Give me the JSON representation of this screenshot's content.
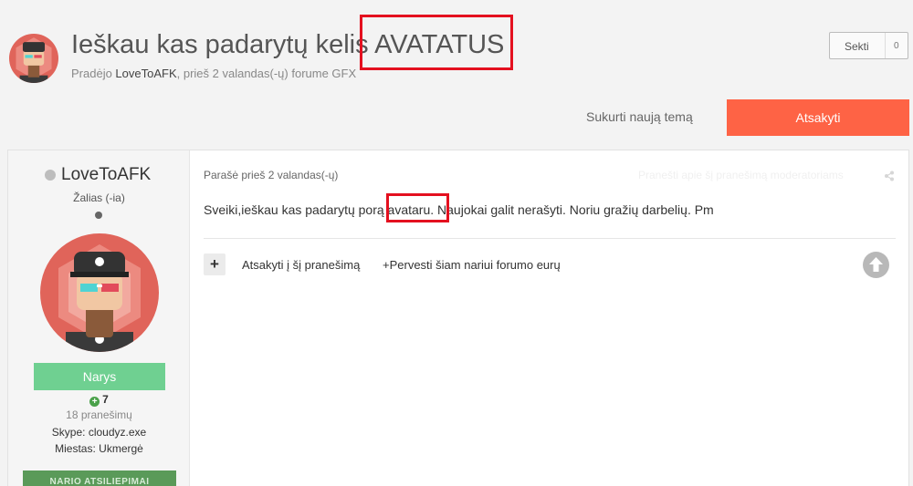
{
  "topic": {
    "title": "Ieškau kas padarytų kelis AVATATUS",
    "started_by_prefix": "Pradėjo ",
    "author": "LoveToAFK",
    "time_text": ", prieš 2 valandas(-ų) forume ",
    "forum": "GFX"
  },
  "follow": {
    "label": "Sekti",
    "count": "0"
  },
  "actions": {
    "new_topic": "Sukurti naują temą",
    "reply": "Atsakyti"
  },
  "author_panel": {
    "name": "LoveToAFK",
    "title": "Žalias (-ia)",
    "group": "Narys",
    "reputation": "7",
    "post_count": "18 pranešimų",
    "skype": "Skype: cloudyz.exe",
    "city": "Miestas: Ukmergė",
    "award_button": "NARIO ATSILIEPIMAI"
  },
  "post": {
    "date": "Parašė prieš 2 valandas(-ų)",
    "report": "Pranešti apie šį pranešimą moderatoriams",
    "text": "Sveiki,ieškau kas padarytų porą avataru. Naujokai galit nerašyti. Noriu gražių darbelių. Pm",
    "quote": "Atsakyti į šį pranešimą",
    "donate": "+Pervesti šiam nariui forumo eurų"
  },
  "colors": {
    "reply_button": "#fe6345",
    "group_badge": "#6fd091",
    "highlight_box": "#e4101f",
    "avatar_bg": "#e0645a"
  }
}
